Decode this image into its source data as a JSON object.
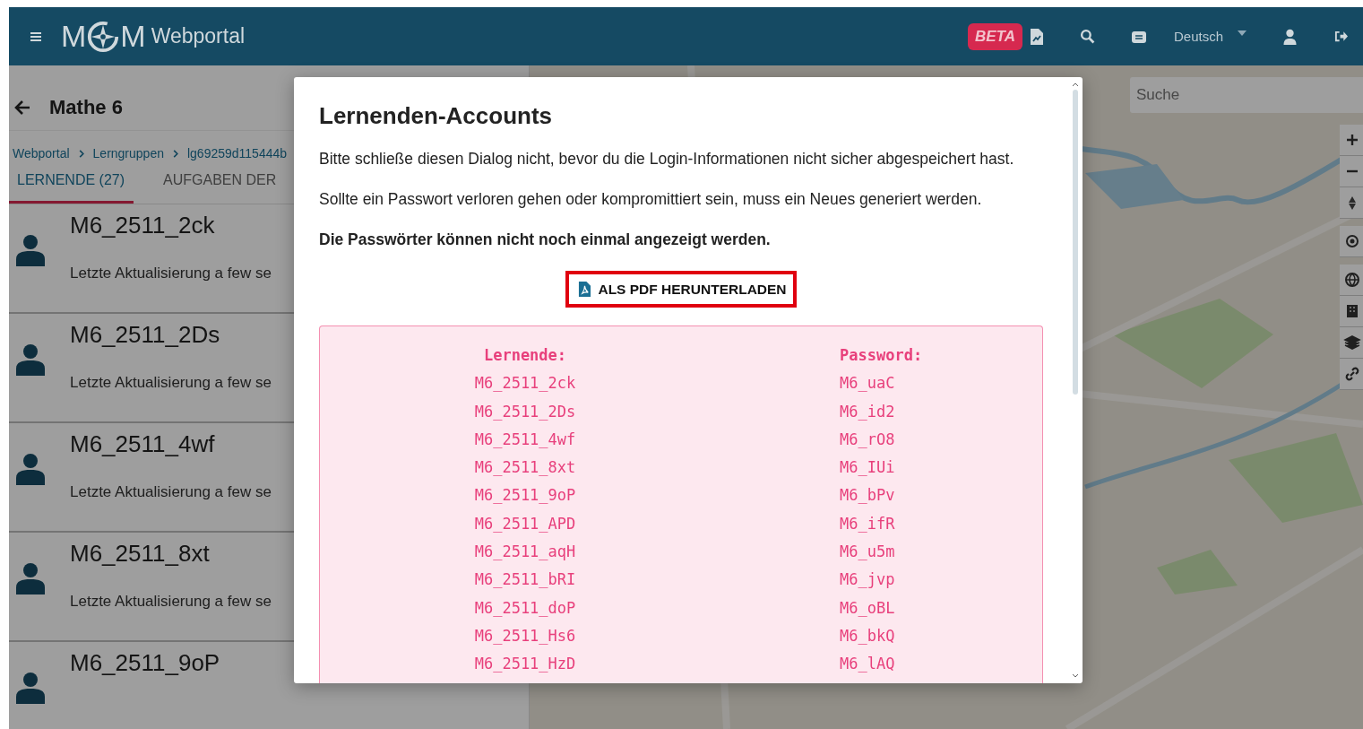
{
  "header": {
    "logo": {
      "letter_left": "M",
      "letter_right": "M",
      "title": "Webportal"
    },
    "beta_badge": "BETA",
    "language": "Deutsch"
  },
  "sidebar": {
    "title": "Mathe 6",
    "breadcrumbs": [
      "Webportal",
      "Lerngruppen",
      "lg69259d115444b"
    ],
    "tabs": [
      {
        "label": "LERNENDE (27)",
        "selected": true
      },
      {
        "label": "AUFGABEN DER",
        "selected": false
      }
    ],
    "students": [
      {
        "name": "M6_2511_2ck",
        "updated": "Letzte Aktualisierung a few se"
      },
      {
        "name": "M6_2511_2Ds",
        "updated": "Letzte Aktualisierung a few se"
      },
      {
        "name": "M6_2511_4wf",
        "updated": "Letzte Aktualisierung a few se"
      },
      {
        "name": "M6_2511_8xt",
        "updated": "Letzte Aktualisierung a few se"
      },
      {
        "name": "M6_2511_9oP"
      }
    ]
  },
  "map": {
    "search": {
      "placeholder": "Suche"
    }
  },
  "dialog": {
    "title": "Lernenden-Accounts",
    "paragraphs": [
      {
        "text": "Bitte schließe diesen Dialog nicht, bevor du die Login-Informationen nicht sicher abgespeichert hast.",
        "bold": false
      },
      {
        "text": "Sollte ein Passwort verloren gehen oder kompromittiert sein, muss ein Neues generiert werden.",
        "bold": false
      },
      {
        "text": "Die Passwörter können nicht noch einmal angezeigt werden.",
        "bold": true
      }
    ],
    "download_button": {
      "label": "ALS PDF HERUNTERLADEN",
      "highlighted": true
    },
    "accounts": {
      "columns": [
        "Lernende:",
        "Password:"
      ],
      "rows": [
        [
          "M6_2511_2ck",
          "M6_uaC"
        ],
        [
          "M6_2511_2Ds",
          "M6_id2"
        ],
        [
          "M6_2511_4wf",
          "M6_rO8"
        ],
        [
          "M6_2511_8xt",
          "M6_IUi"
        ],
        [
          "M6_2511_9oP",
          "M6_bPv"
        ],
        [
          "M6_2511_APD",
          "M6_ifR"
        ],
        [
          "M6_2511_aqH",
          "M6_u5m"
        ],
        [
          "M6_2511_bRI",
          "M6_jvp"
        ],
        [
          "M6_2511_doP",
          "M6_oBL"
        ],
        [
          "M6_2511_Hs6",
          "M6_bkQ"
        ],
        [
          "M6_2511_HzD",
          "M6_lAQ"
        ]
      ]
    }
  }
}
